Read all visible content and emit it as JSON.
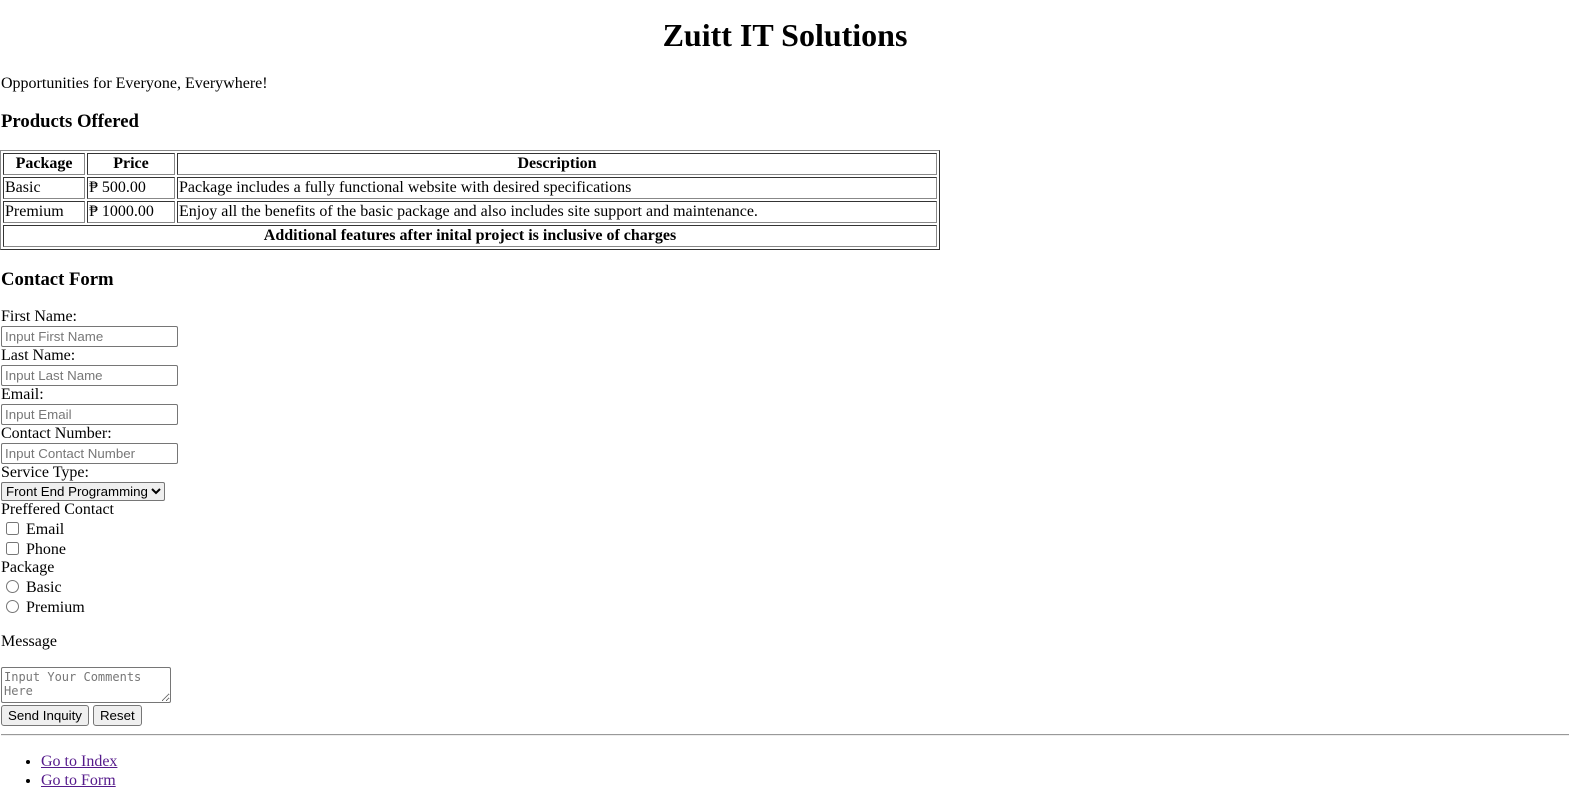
{
  "header": {
    "title": "Zuitt IT Solutions",
    "tagline": "Opportunities for Everyone, Everywhere!"
  },
  "products": {
    "heading": "Products Offered",
    "columns": [
      "Package",
      "Price",
      "Description"
    ],
    "rows": [
      [
        "Basic",
        "₱ 500.00",
        "Package includes a fully functional website with desired specifications"
      ],
      [
        "Premium",
        "₱ 1000.00",
        "Enjoy all the benefits of the basic package and also includes site support and maintenance."
      ]
    ],
    "footer": "Additional features after inital project is inclusive of charges"
  },
  "form": {
    "heading": "Contact Form",
    "first_name_label": "First Name:",
    "first_name_placeholder": "Input First Name",
    "last_name_label": "Last Name:",
    "last_name_placeholder": "Input Last Name",
    "email_label": "Email:",
    "email_placeholder": "Input Email",
    "contact_label": "Contact Number:",
    "contact_placeholder": "Input Contact Number",
    "service_label": "Service Type:",
    "service_selected": "Front End Programming",
    "preferred_label": "Preffered Contact",
    "preferred_options": [
      "Email",
      "Phone"
    ],
    "package_label": "Package",
    "package_options": [
      "Basic",
      "Premium"
    ],
    "message_label": "Message",
    "message_placeholder": "Input Your Comments Here",
    "submit_label": "Send Inquity",
    "reset_label": "Reset"
  },
  "links": [
    "Go to Index",
    "Go to Form"
  ]
}
